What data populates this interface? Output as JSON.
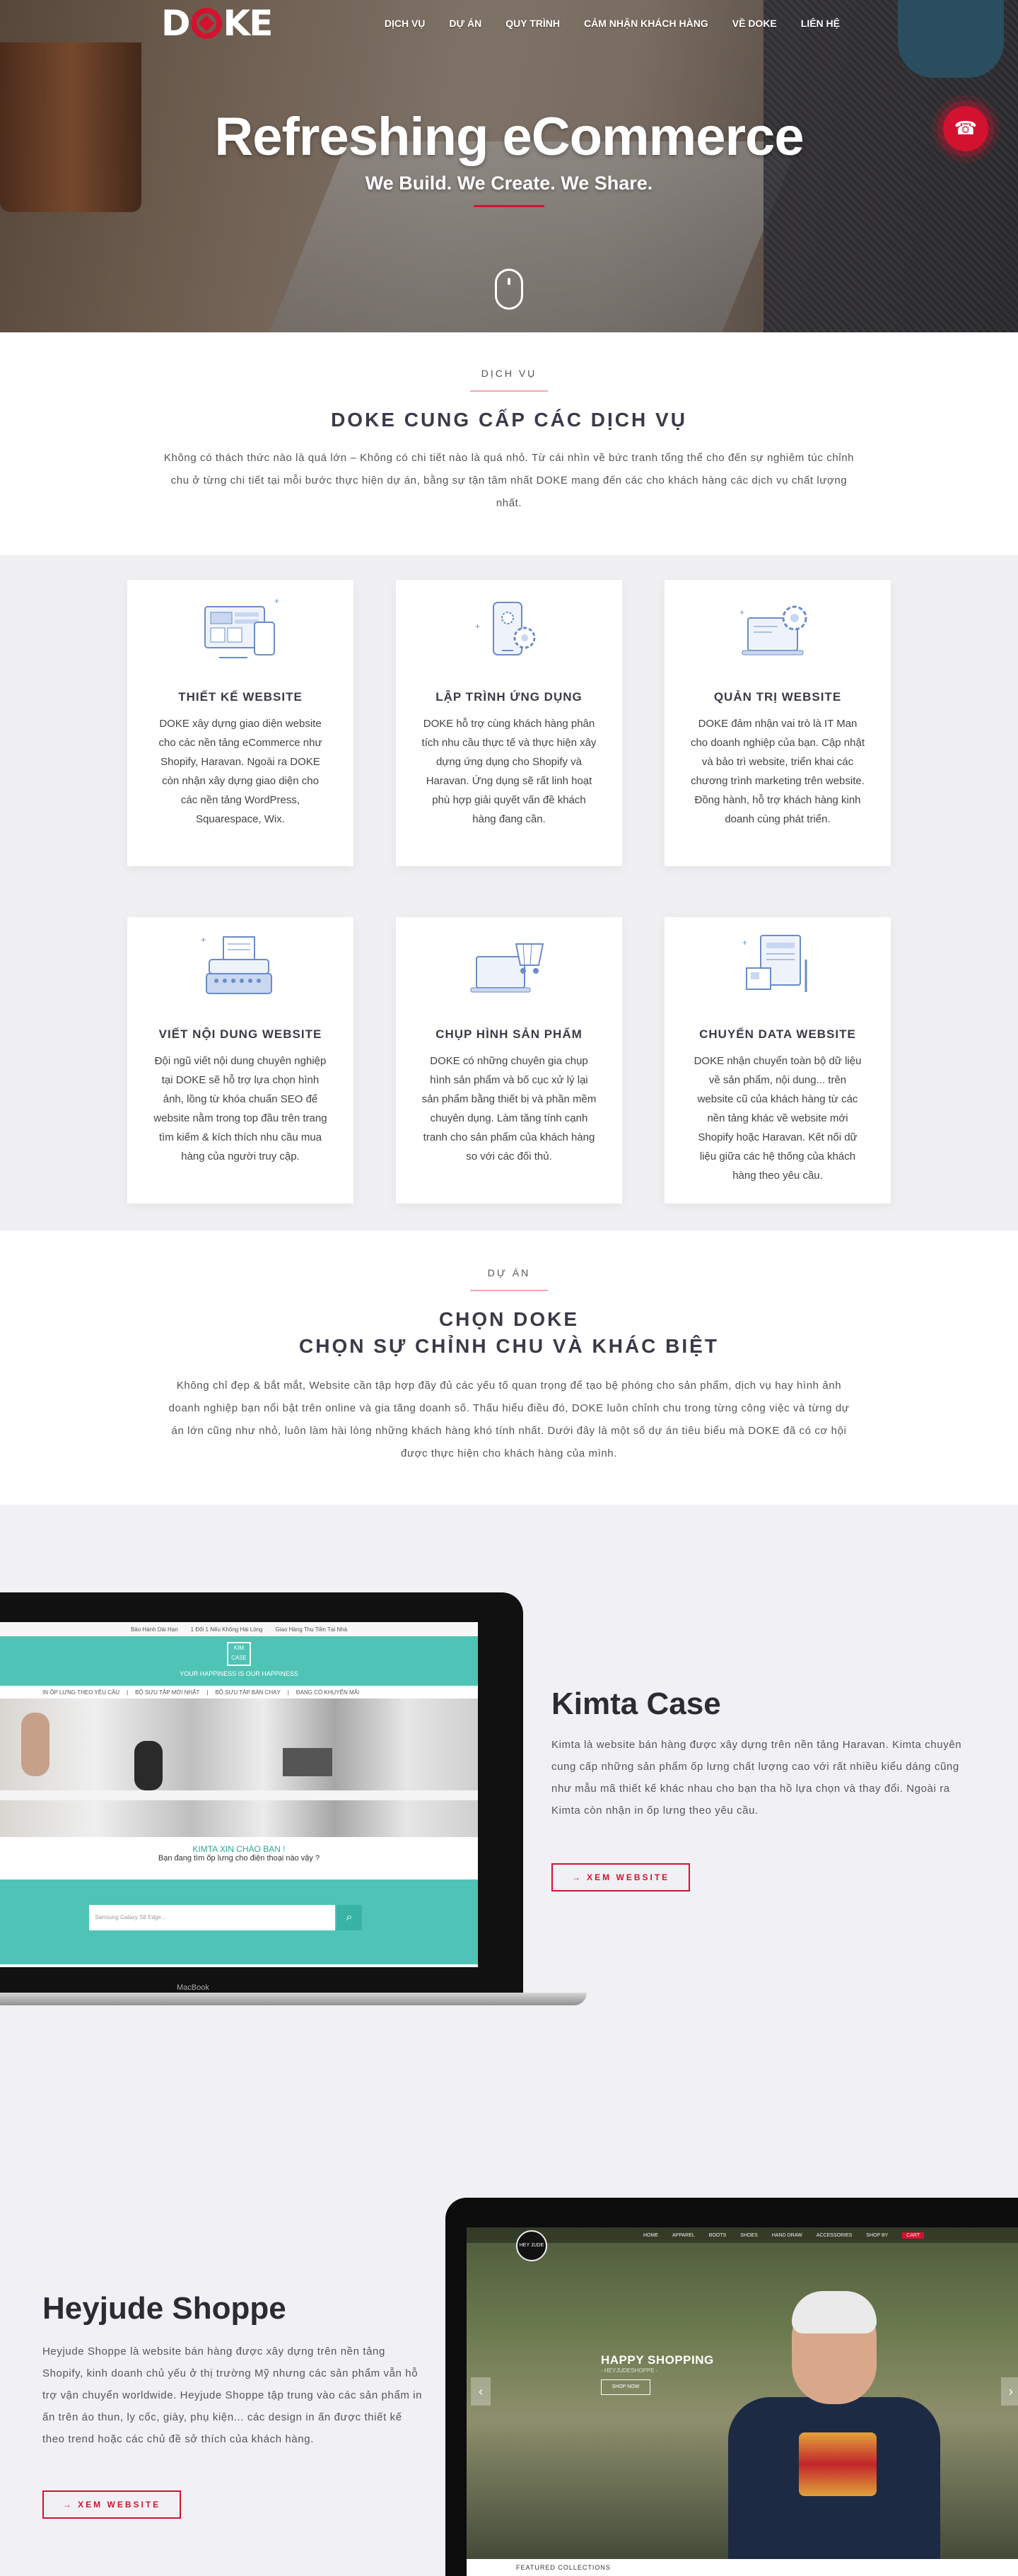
{
  "brand": {
    "accent": "#d3122f",
    "teal": "#4fc4b6"
  },
  "nav": {
    "logo": "DOKE",
    "items": [
      "DỊCH VỤ",
      "DỰ ÁN",
      "QUY TRÌNH",
      "CẢM NHẬN KHÁCH HÀNG",
      "VỀ DOKE",
      "LIÊN HỆ"
    ]
  },
  "hero": {
    "title": "Refreshing eCommerce",
    "subtitle": "We Build. We Create. We Share.",
    "phone_icon": "phone-icon",
    "scroll_icon": "mouse-scroll-icon"
  },
  "services": {
    "kicker": "DỊCH VỤ",
    "title": "DOKE CUNG CẤP CÁC DỊCH VỤ",
    "intro": "Không có thách thức nào là quá lớn – Không có chi tiết nào là quá nhỏ. Từ cái nhìn về bức tranh tổng thể cho đến sự nghiêm túc chỉnh chu ở từng chi tiết tại mỗi bước thực hiện dự án, bằng sự tận tâm nhất DOKE mang đến các cho khách hàng các dịch vụ chất lượng nhất.",
    "cards": [
      {
        "title": "THIẾT KẾ WEBSITE",
        "icon": "web-design-icon",
        "text": "DOKE xây dựng giao diện website cho các nền tảng eCommerce như Shopify, Haravan. Ngoài ra DOKE còn nhận xây dựng giao diện cho các nền tảng WordPress, Squarespace, Wix."
      },
      {
        "title": "LẬP TRÌNH ỨNG DỤNG",
        "icon": "app-development-icon",
        "text": "DOKE hỗ trợ cùng khách hàng phân tích nhu cầu thực tế và thực hiện xây dựng ứng dụng cho Shopify và Haravan. Ứng dụng sẽ rất linh hoạt phù hợp giải quyết vấn đề khách hàng đang cần."
      },
      {
        "title": "QUẢN TRỊ WEBSITE",
        "icon": "website-admin-icon",
        "text": "DOKE đảm nhận vai trò là IT Man cho doanh nghiệp của bạn. Cập nhật và bảo trì website, triển khai các chương trình marketing trên website. Đồng hành, hỗ trợ khách hàng kinh doanh cùng phát triển."
      },
      {
        "title": "VIẾT NỘI DUNG WEBSITE",
        "icon": "typewriter-icon",
        "text": "Đội ngũ viết nội dung chuyên nghiệp tại DOKE sẽ hỗ trợ lựa chọn hình ảnh, lồng từ khóa chuẩn SEO để website nằm trong top đầu trên trang tìm kiếm & kích thích nhu cầu mua hàng của người truy cập."
      },
      {
        "title": "CHỤP HÌNH SẢN PHẨM",
        "icon": "product-photo-icon",
        "text": "DOKE có những chuyên gia chụp hình sản phẩm và bố cục xử lý lại sản phẩm bằng thiết bị và phần mềm chuyên dụng. Làm tăng tính cạnh tranh cho sản phẩm của khách hàng so với các đối thủ."
      },
      {
        "title": "CHUYỂN DATA WEBSITE",
        "icon": "data-transfer-icon",
        "text": "DOKE nhận chuyển toàn bộ dữ liệu về sản phẩm, nội dung... trên website cũ của khách hàng từ các nền tảng khác về website mới Shopify hoặc Haravan. Kết nối dữ liệu giữa các hệ thống của khách hàng theo yêu cầu."
      }
    ]
  },
  "projects": {
    "kicker": "DỰ ÁN",
    "title_line1": "CHỌN DOKE",
    "title_line2": "CHỌN SỰ CHỈNH CHU VÀ KHÁC BIỆT",
    "intro": "Không chỉ đẹp & bắt mắt, Website cần tập hợp đầy đủ các yếu tố quan trọng để tạo bệ phóng cho sản phẩm, dịch vụ hay hình ảnh doanh nghiệp bạn nổi bật trên online và gia tăng doanh số. Thấu hiểu điều đó, DOKE luôn chỉnh chu trong từng công việc và từng dự án lớn cũng như nhỏ, luôn làm hài lòng những khách hàng khó tính nhất. Dưới đây là một số dự án tiêu biểu mà DOKE đã có cơ hội được thực hiện cho khách hàng của mình.",
    "items": [
      {
        "name": "Kimta Case",
        "text": "Kimta là website bán hàng được xây dựng trên nền tảng Haravan. Kimta chuyên cung cấp những sản phẩm ốp lưng chất lượng cao với rất nhiều kiểu dáng cũng như mẫu mã thiết kế khác nhau cho bạn tha hồ lựa chọn và thay đổi. Ngoài ra Kimta còn nhận in ốp lưng theo yêu cầu.",
        "button": "→ XEM WEBSITE",
        "screen": {
          "topbar": [
            "Bảo Hành Dài Hạn",
            "1 Đổi 1 Nếu Không Hài Lòng",
            "Giao Hàng Thu Tiền Tại Nhà"
          ],
          "logo": "KIM CASE",
          "tagline": "YOUR HAPPINESS IS OUR HAPPINESS",
          "menu": [
            "IN ỐP LƯNG THEO YÊU CẦU",
            "BỘ SƯU TẬP MỚI NHẤT",
            "BỘ SƯU TẬP BÁN CHẠY",
            "ĐANG CÓ KHUYẾN MÃI"
          ],
          "welcome": "KIMTA XIN CHÀO BẠN !",
          "question": "Bạn đang tìm ốp lưng cho điện thoại nào vậy ?",
          "search_placeholder": "Samsung Galaxy S8 Edge...",
          "device": "MacBook"
        }
      },
      {
        "name": "Heyjude Shoppe",
        "text": "Heyjude Shoppe là website bán hàng được xây dựng trên nền tảng Shopify, kinh doanh chủ yếu ở thị trường Mỹ nhưng các sản phẩm vẫn hỗ trợ vận chuyển worldwide. Heyjude Shoppe tập trung vào các sản phẩm in ấn trên áo thun, ly cốc, giày, phụ kiện... các design in ấn được thiết kế theo trend hoặc các chủ đề sở thích của khách hàng.",
        "button": "→ XEM WEBSITE",
        "screen": {
          "logo": "HEY JUDE",
          "menu": [
            "HOME",
            "APPAREL",
            "BOOTS",
            "SHOES",
            "HAND DRAW",
            "ACCESSORIES",
            "SHOP BY",
            "CART"
          ],
          "slide_title": "HAPPY SHOPPING",
          "slide_sub": "- HEYJUDESHOPPE -",
          "slide_button": "SHOP NOW",
          "featured": "FEATURED COLLECTIONS"
        }
      }
    ]
  }
}
